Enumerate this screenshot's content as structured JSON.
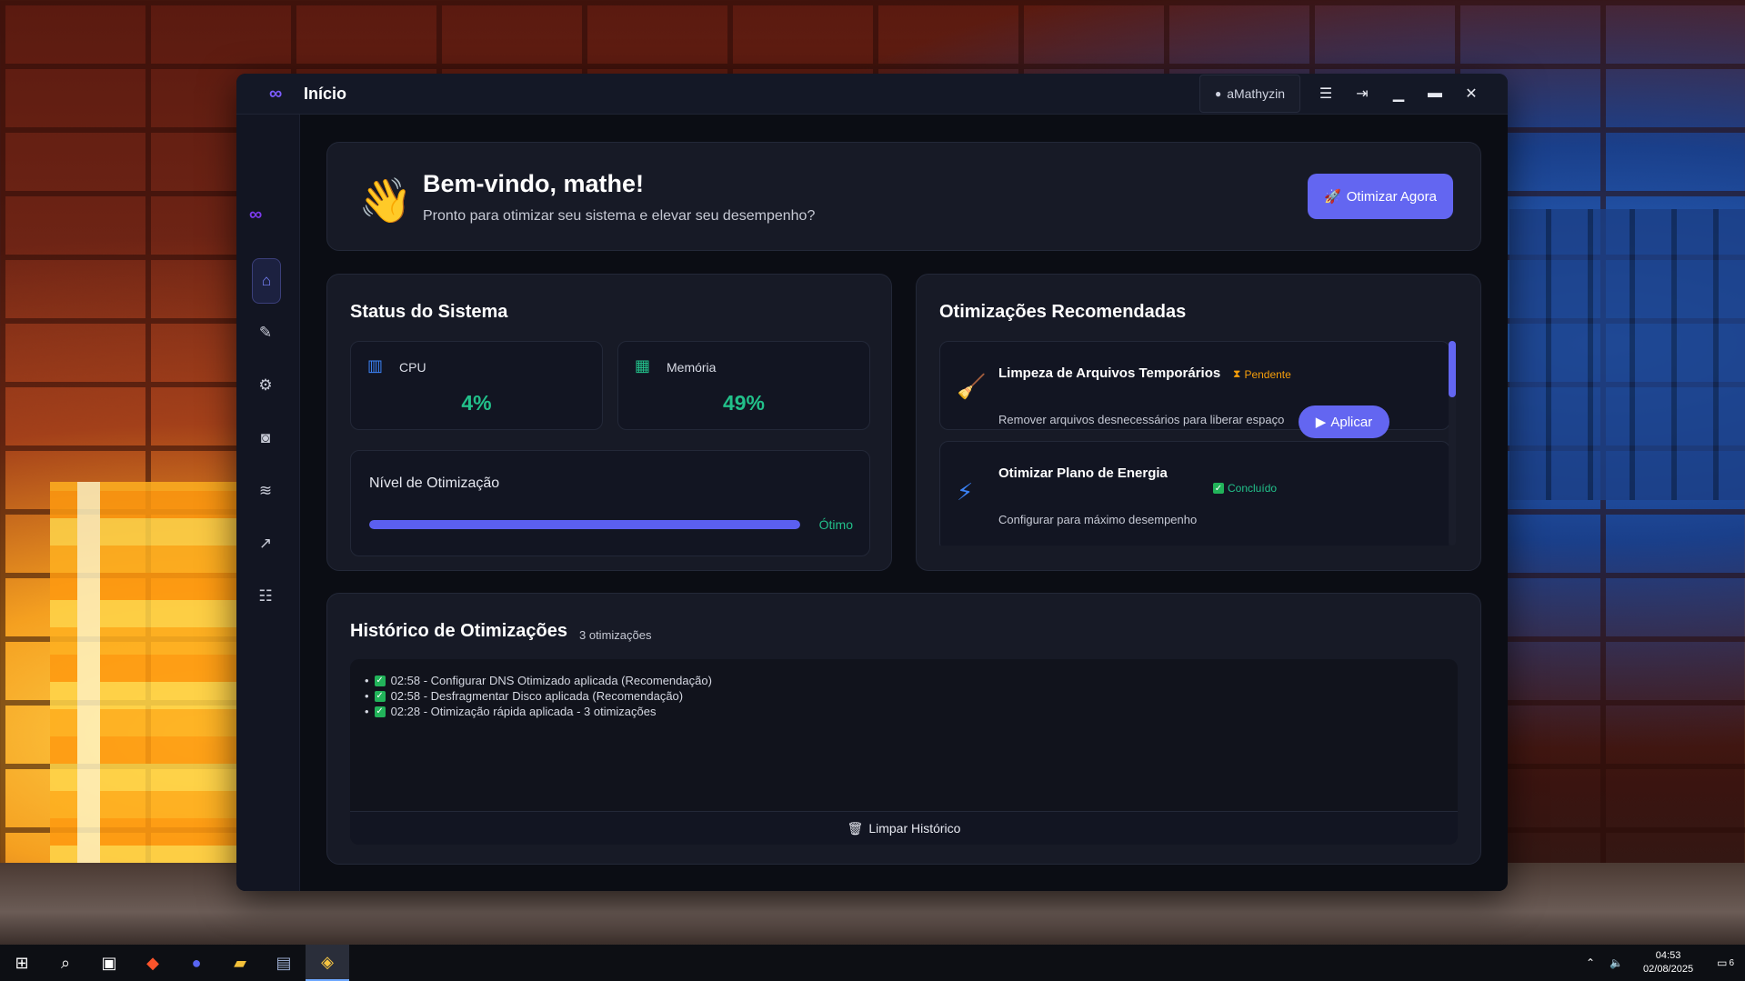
{
  "window": {
    "title": "Início",
    "user": "aMathyzin"
  },
  "welcome": {
    "title": "Bem-vindo, mathe!",
    "subtitle": "Pronto para otimizar seu sistema e elevar seu desempenho?",
    "button": "Otimizar Agora"
  },
  "status": {
    "title": "Status do Sistema",
    "cpu_label": "CPU",
    "cpu_value": "4%",
    "mem_label": "Memória",
    "mem_value": "49%",
    "level_label": "Nível de Otimização",
    "level_state": "Ótimo",
    "level_fraction": 1.0
  },
  "recommendations": {
    "title": "Otimizações Recomendadas",
    "items": [
      {
        "title": "Limpeza de Arquivos Temporários",
        "status": "Pendente",
        "desc": "Remover arquivos desnecessários para liberar espaço",
        "action": "Aplicar"
      },
      {
        "title": "Otimizar Plano de Energia",
        "status": "Concluído",
        "desc": "Configurar para máximo desempenho"
      }
    ]
  },
  "history": {
    "title": "Histórico de Otimizações",
    "count": "3 otimizações",
    "entries": [
      "02:58 - Configurar DNS Otimizado aplicada (Recomendação)",
      "02:58 - Desfragmentar Disco aplicada (Recomendação)",
      "02:28 - Otimização rápida aplicada - 3 otimizações"
    ],
    "clear": "Limpar Histórico"
  },
  "taskbar": {
    "time": "04:53",
    "date": "02/08/2025",
    "notifications": "6"
  },
  "colors": {
    "accent": "#6366f1",
    "success": "#22c08a",
    "pending": "#f59e0b"
  }
}
